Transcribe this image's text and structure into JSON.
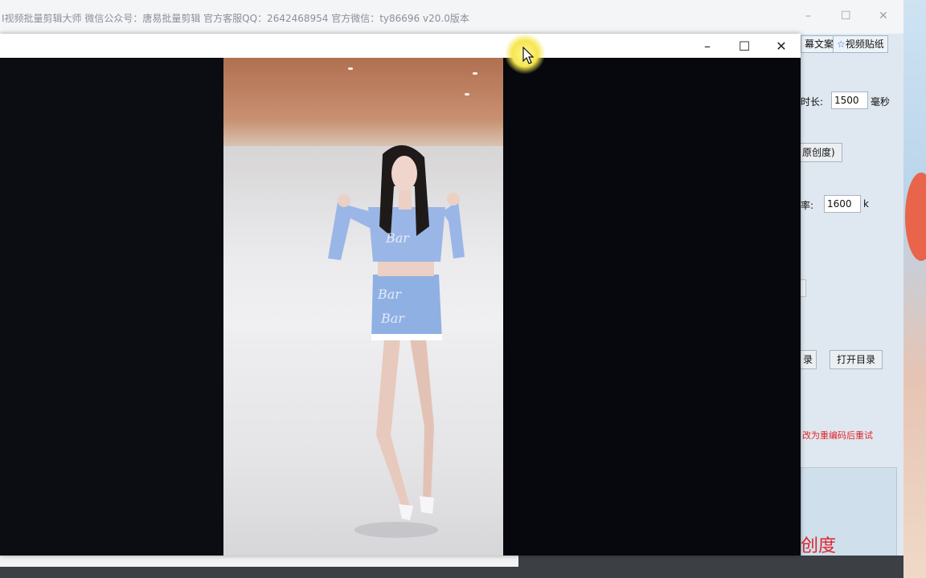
{
  "background_app": {
    "title": "I视频批量剪辑大师   微信公众号：唐易批量剪辑   官方客服QQ：2642468954   官方微信：ty86696   v20.0版本",
    "controls": {
      "minimize": "–",
      "maximize": "☐",
      "close": "✕"
    },
    "tabs": [
      {
        "label": "幕文案"
      },
      {
        "label": "视频贴纸"
      }
    ],
    "fields": {
      "duration_label": "时长:",
      "duration_value": "1500",
      "duration_unit": "毫秒",
      "originality_label": "原创度)",
      "bitrate_label": "率:",
      "bitrate_value": "1600",
      "bitrate_unit": "k"
    },
    "buttons": {
      "dir_partial": "录",
      "open_dir": "打开目录"
    },
    "warning": "改为重编码后重试",
    "big_label": "创度"
  },
  "player": {
    "controls": {
      "minimize": "–",
      "maximize": "☐",
      "close": "✕"
    }
  },
  "colors": {
    "warning": "#e0242a",
    "panel_bg": "#dfe8f0",
    "player_bg": "#05060b"
  }
}
